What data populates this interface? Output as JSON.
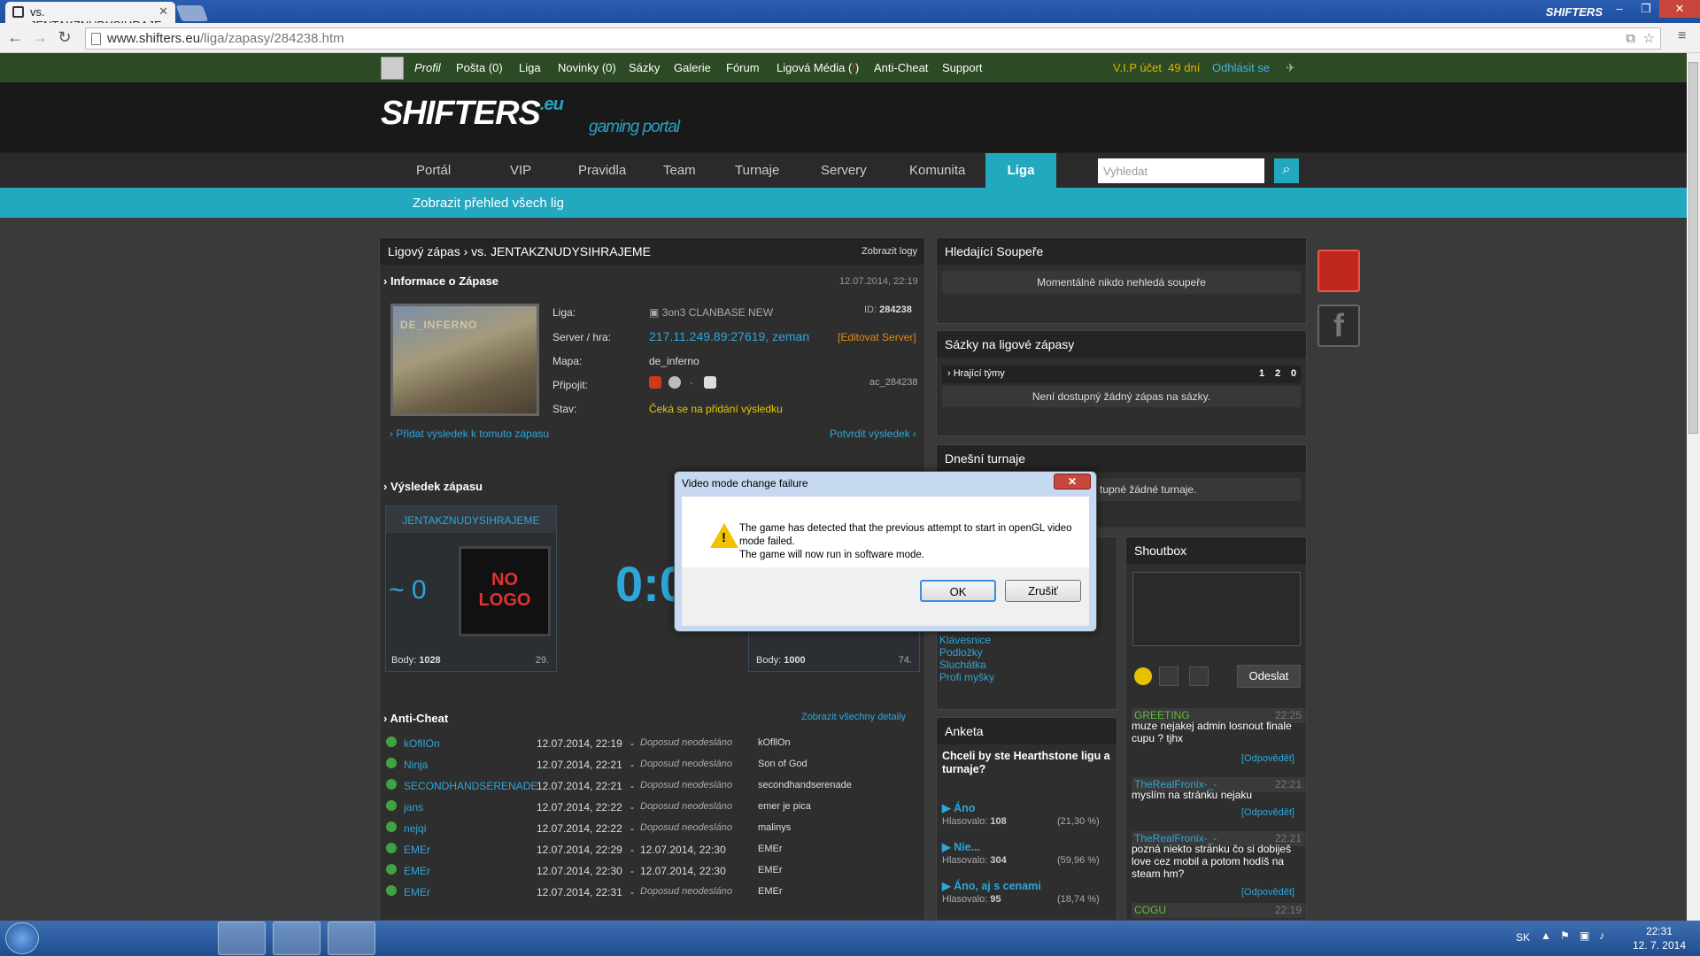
{
  "browser": {
    "tab_title": "vs. JENTAKZNUDYSIHRAJE",
    "url_host": "www.shifters.eu",
    "url_path": "/liga/zapasy/284238.htm",
    "title_logo": "SHIFTERS"
  },
  "topbar": {
    "items": [
      "Profil",
      "Pošta (0)",
      "Liga",
      "Novinky (0)",
      "Sázky",
      "Galerie",
      "Fórum",
      "Ligová Média (",
      "Anti-Cheat",
      "Support"
    ],
    "media_badge": "!",
    "media_close": ")",
    "vip": "V.I.P účet",
    "vip_days": "49 dní",
    "logout": "Odhlásit se"
  },
  "header": {
    "logo": "SHIFTERS",
    "logo_eu": ".eu",
    "logo_sub": "gaming portal"
  },
  "mainnav": {
    "items": [
      "Portál",
      "VIP",
      "Pravidla",
      "Team",
      "Turnaje",
      "Servery",
      "Komunita"
    ],
    "active": "Liga",
    "search_placeholder": "Vyhledat"
  },
  "subnav": {
    "label": "Zobrazit přehled všech lig"
  },
  "match": {
    "breadcrumb": "Ligový zápas › vs. JENTAKZNUDYSIHRAJEME",
    "show_logs": "Zobrazit logy",
    "info_title": "› Informace o Zápase",
    "info_date": "12.07.2014, 22:19",
    "map_thumb_label": "DE_INFERNO",
    "league_label": "Liga:",
    "league_value": "3on3 CLANBASE NEW",
    "id_label": "ID:",
    "id_value": "284238",
    "server_label": "Server / hra:",
    "server_value": "217.11.249.89:27619, zeman",
    "edit_server": "[Editovat Server]",
    "map_label": "Mapa:",
    "map_value": "de_inferno",
    "connect_label": "Připojit:",
    "connect_sep": "-",
    "ac_code": "ac_284238",
    "state_label": "Stav:",
    "state_value": "Čeká se na přidání výsledku",
    "add_result": "› Přidat výsledek k tomuto zápasu",
    "confirm_result": "Potvrdit výsledek ‹",
    "result_title": "› Výsledek zápasu",
    "team1": "JENTAKZNUDYSIHRAJEME",
    "team1_rank": "~ 0",
    "no_logo": "NO LOGO",
    "score": "0:0",
    "team1_points_label": "Body:",
    "team1_points": "1028",
    "team1_pos": "29.",
    "team2_points_label": "Body:",
    "team2_points": "1000",
    "team2_pos": "74."
  },
  "anticheat": {
    "title": "› Anti-Cheat",
    "show_all": "Zobrazit všechny detaily",
    "rows": [
      {
        "name": "kOflIOn",
        "start": "12.07.2014, 22:19",
        "end": "Doposud neodesláno",
        "alias": "kOfllOn",
        "sent": false
      },
      {
        "name": "Ninja",
        "start": "12.07.2014, 22:21",
        "end": "Doposud neodesláno",
        "alias": "Son of God",
        "sent": false
      },
      {
        "name": "SECONDHANDSERENADE",
        "start": "12.07.2014, 22:21",
        "end": "Doposud neodesláno",
        "alias": "secondhandserenade",
        "sent": false
      },
      {
        "name": "jans",
        "start": "12.07.2014, 22:22",
        "end": "Doposud neodesláno",
        "alias": "emer je pica",
        "sent": false
      },
      {
        "name": "nejqi",
        "start": "12.07.2014, 22:22",
        "end": "Doposud neodesláno",
        "alias": "malinys",
        "sent": false
      },
      {
        "name": "EMEr",
        "start": "12.07.2014, 22:29",
        "end": "12.07.2014, 22:30",
        "alias": "EMEr",
        "sent": true
      },
      {
        "name": "EMEr",
        "start": "12.07.2014, 22:30",
        "end": "12.07.2014, 22:30",
        "alias": "EMEr",
        "sent": true
      },
      {
        "name": "EMEr",
        "start": "12.07.2014, 22:31",
        "end": "Doposud neodesláno",
        "alias": "EMEr",
        "sent": false
      }
    ]
  },
  "right": {
    "opponents_title": "Hledající Soupeře",
    "opponents_msg": "Momentálně nikdo nehledá soupeře",
    "bets_title": "Sázky na ligové zápasy",
    "bets_teams": "› Hrající týmy",
    "bets_cols": [
      "1",
      "2",
      "0"
    ],
    "bets_msg": "Není dostupný žádný zápas na sázky.",
    "tourn_title": "Dnešní turnaje",
    "tourn_msg": "tupné žádné turnaje.",
    "shop_links": [
      "Klávesnice",
      "Podložky",
      "Sluchátka",
      "Profi myšky"
    ],
    "poll_title": "Anketa",
    "poll_question": "Chceli by ste Hearthstone ligu a turnaje?",
    "poll_options": [
      {
        "label": "▶ Áno",
        "votes_label": "Hlasovalo:",
        "votes": "108",
        "pct": "(21,30 %)"
      },
      {
        "label": "▶ Nie...",
        "votes_label": "Hlasovalo:",
        "votes": "304",
        "pct": "(59,96 %)"
      },
      {
        "label": "▶ Áno, aj s cenami",
        "votes_label": "Hlasovalo:",
        "votes": "95",
        "pct": "(18,74 %)"
      }
    ]
  },
  "shoutbox": {
    "title": "Shoutbox",
    "send": "Odeslat",
    "reply": "[Odpovědět]",
    "messages": [
      {
        "user": "GREETING",
        "time": "22:25",
        "text": "muze nejakej admin losnout finale cupu ? tjhx",
        "color": "#5fbf3a"
      },
      {
        "user": "TheRealFronix-_-",
        "time": "22:21",
        "text": "myslím na stránku nejaku",
        "color": "#2ea6d8"
      },
      {
        "user": "TheRealFronix-_-",
        "time": "22:21",
        "text": "pozná niekto stránku čo si dobiješ love cez mobil a potom hodíš na steam hm?",
        "color": "#2ea6d8"
      },
      {
        "user": "COGU",
        "time": "22:19",
        "text": "",
        "color": "#5fbf3a"
      }
    ]
  },
  "dialog": {
    "title": "Video mode change failure",
    "close": "✕",
    "line1": "The game has detected that the previous attempt to start in openGL video mode failed.",
    "line2": "The game will now run in software mode.",
    "ok": "OK",
    "cancel": "Zrušiť"
  },
  "taskbar": {
    "lang": "SK",
    "time": "22:31",
    "date": "12. 7. 2014"
  },
  "colors": {
    "accent": "#22a8bf",
    "topbar": "#2c4a23",
    "link": "#2ea6d8",
    "status": "#e6c800"
  }
}
